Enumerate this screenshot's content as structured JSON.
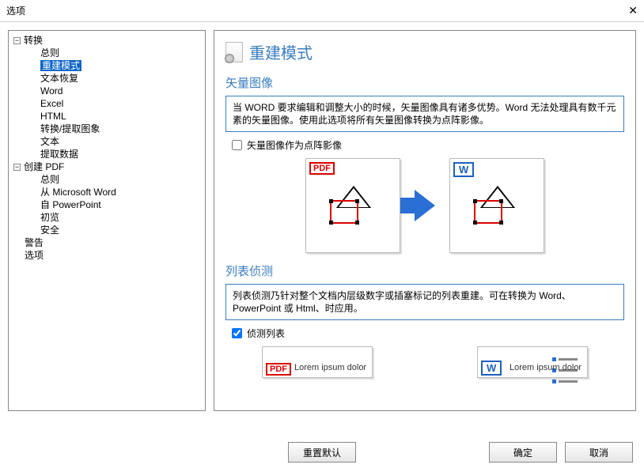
{
  "window": {
    "title": "选项",
    "close": "✕"
  },
  "tree": {
    "convert": {
      "label": "转换",
      "items": [
        "总则",
        "重建模式",
        "文本恢复",
        "Word",
        "Excel",
        "HTML",
        "转换/提取图象",
        "文本",
        "提取数据"
      ]
    },
    "create": {
      "label": "创建 PDF",
      "items": [
        "总则",
        "从 Microsoft Word",
        "自 PowerPoint",
        "初览",
        "安全"
      ]
    },
    "warn": "警告",
    "options": "选项",
    "selected": "重建模式"
  },
  "main": {
    "title": "重建模式",
    "section1": {
      "heading": "矢量图像",
      "info": "当 WORD 要求编辑和调整大小的时候，矢量图像具有诸多优势。Word 无法处理具有数千元素的矢量图像。使用此选项将所有矢量图像转换为点阵影像。",
      "checkbox": "矢量图像作为点阵影像",
      "checked": false,
      "badge_pdf": "PDF",
      "badge_w": "W"
    },
    "section2": {
      "heading": "列表侦测",
      "info": "列表侦测乃针对整个文档内层级数字或插塞标记的列表重建。可在转换为 Word、PowerPoint 或 Html、时应用。",
      "checkbox": "侦测列表",
      "checked": true,
      "badge_pdf": "PDF",
      "badge_w": "W",
      "lorem": "Lorem ipsum dolor"
    }
  },
  "buttons": {
    "reset": "重置默认",
    "ok": "确定",
    "cancel": "取消"
  }
}
